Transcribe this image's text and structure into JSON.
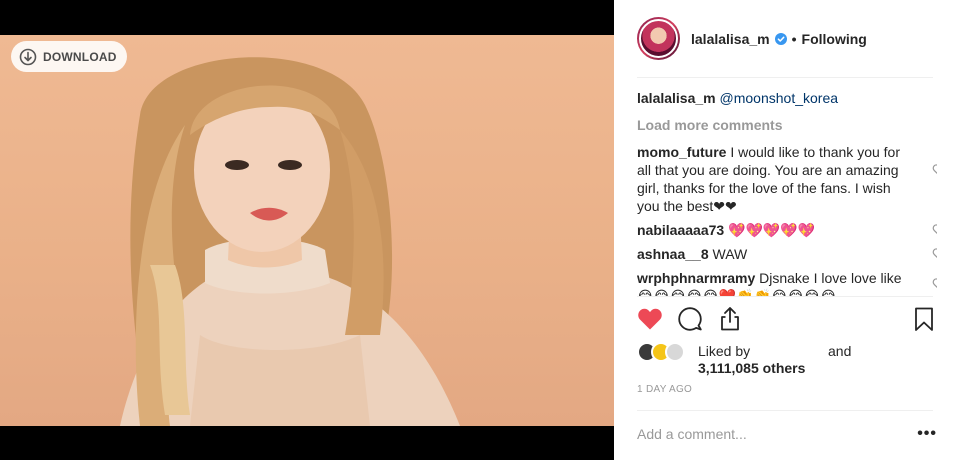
{
  "photo": {
    "download_label": "DOWNLOAD",
    "background_color": "#eab189"
  },
  "post_header": {
    "username": "lalalalisa_m",
    "separator": "•",
    "follow_state": "Following",
    "verified_color": "#3897f0"
  },
  "caption": {
    "username": "lalalalisa_m",
    "mention": "@moonshot_korea"
  },
  "load_more": "Load more comments",
  "comments": [
    {
      "username": "momo_future",
      "text": " I would like to thank you for all that you are doing. You are an amazing girl, thanks for the love of the fans. I wish you the best❤❤"
    },
    {
      "username": "nabilaaaaa73",
      "text": " 💖💖💖💖💖"
    },
    {
      "username": "ashnaa__8",
      "text": " WAW"
    },
    {
      "username": "wrphphnarmramy",
      "text": " Djsnake I love love like 😂😂😂😂😂❤️👏👏😂😂😂😂"
    }
  ],
  "likes": {
    "prefix": "Liked by",
    "and": "and",
    "count": "3,111,085 others"
  },
  "timestamp": "1 DAY AGO",
  "add_comment": {
    "placeholder": "Add a comment...",
    "more": "•••"
  },
  "colors": {
    "liked_heart": "#ed4956",
    "secondary_text": "#999999",
    "mention": "#003569"
  }
}
